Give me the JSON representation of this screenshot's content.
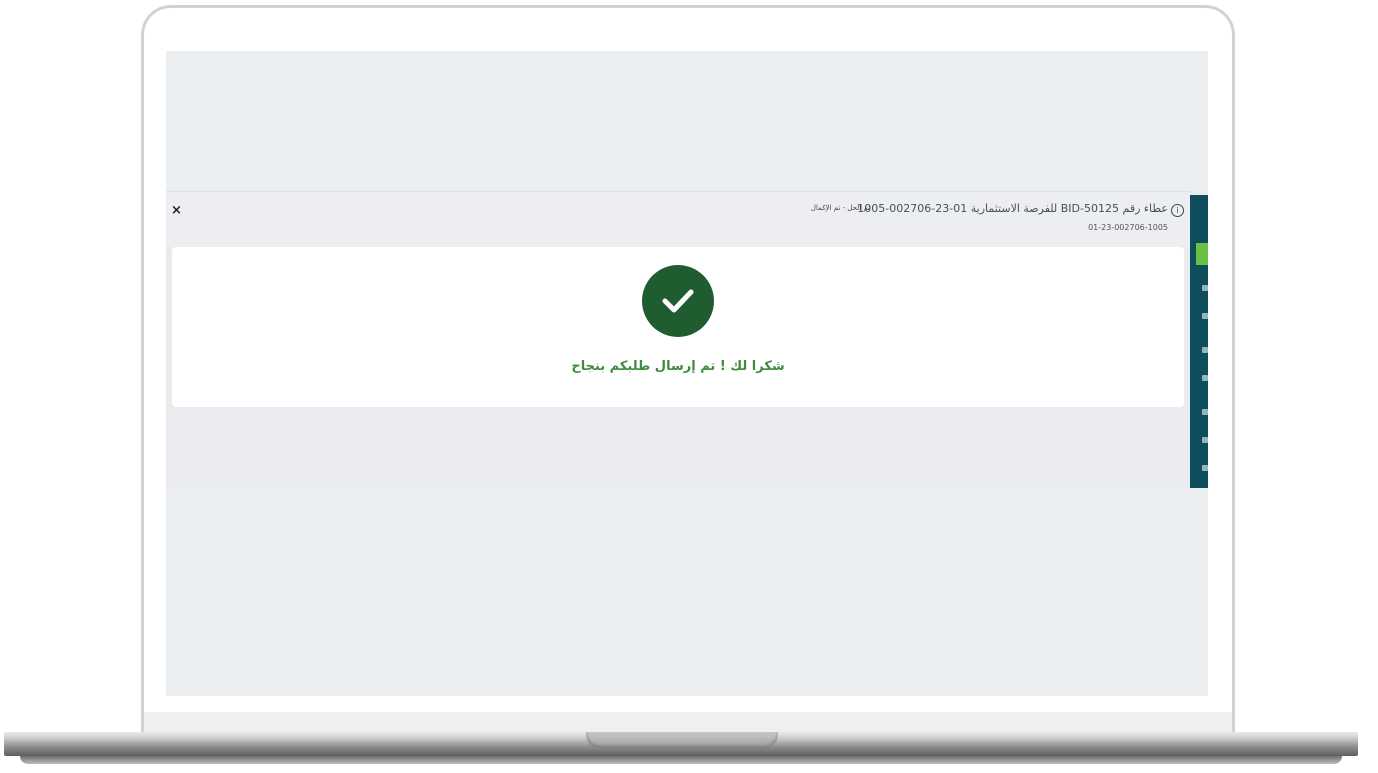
{
  "dialog": {
    "title": "عطاء رقم BID-50125 للفرصة الاستثمارية 01-23-002706-1005",
    "status": "تم الحل - تم الإكمال",
    "reference_id": "01-23-002706-1005",
    "close_label": "×",
    "info_label": "i"
  },
  "confirmation": {
    "message": "شكرا لك ! تم إرسال طلبكم بنجاح",
    "icon": "check-icon"
  },
  "colors": {
    "success_green": "#1f5c30",
    "message_green": "#3d8c3f",
    "sidebar_teal": "#0e4d5c",
    "sidebar_accent": "#6bbf45"
  }
}
